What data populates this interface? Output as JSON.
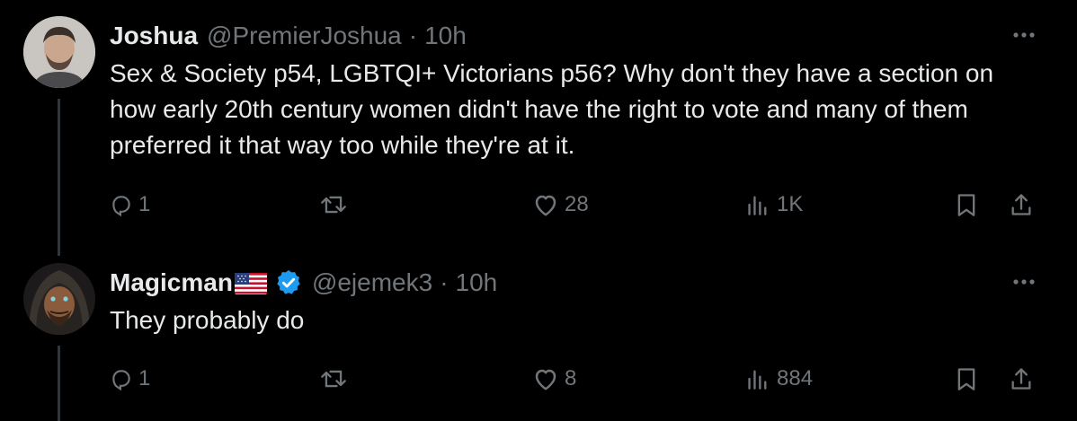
{
  "tweets": [
    {
      "display_name": "Joshua",
      "handle": "@PremierJoshua",
      "separator": "·",
      "time": "10h",
      "text": "Sex & Society p54, LGBTQI+ Victorians p56? Why don't they have a section on how early 20th century women didn't have the right to vote and many of them preferred it that way too while they're at it.",
      "replies": "1",
      "reposts": "",
      "likes": "28",
      "views": "1K"
    },
    {
      "display_name": "Magicman",
      "flag": "us-flag-emoji",
      "verified": true,
      "handle": "@ejemek3",
      "separator": "·",
      "time": "10h",
      "text": "They probably do",
      "replies": "1",
      "reposts": "",
      "likes": "8",
      "views": "884"
    }
  ],
  "colors": {
    "background": "#000000",
    "text_primary": "#e7e9ea",
    "text_secondary": "#71767b",
    "verified_blue": "#1d9bf0",
    "thread_line": "#333639"
  },
  "icons": [
    "reply-icon",
    "repost-icon",
    "like-icon",
    "views-icon",
    "bookmark-icon",
    "share-icon",
    "more-icon",
    "verified-badge-icon"
  ]
}
